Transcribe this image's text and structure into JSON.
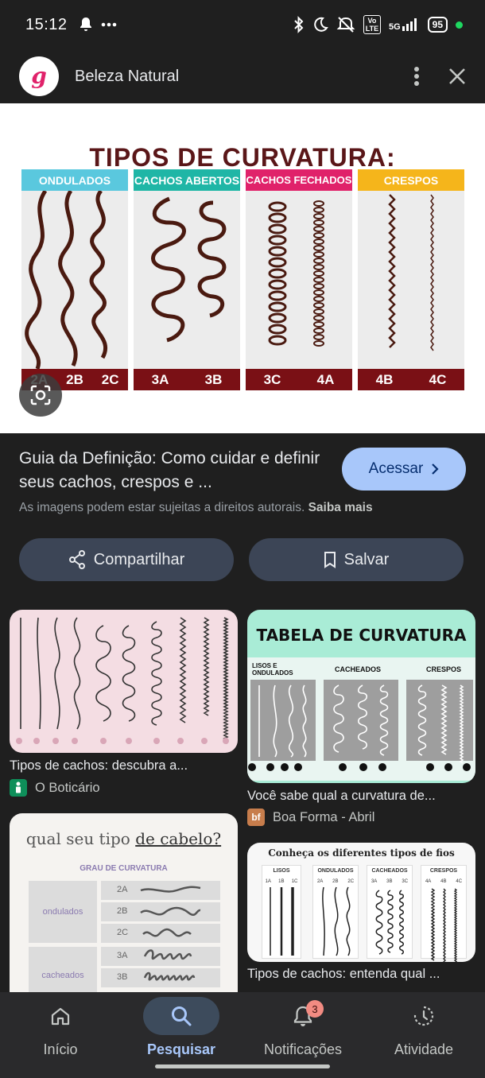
{
  "status_bar": {
    "time": "15:12",
    "lte_label": "Vo LTE",
    "network": "5G",
    "battery": "95",
    "icons": [
      "notification-bell-icon",
      "more-dots-icon",
      "bluetooth-icon",
      "moon-icon",
      "mute-icon",
      "signal-icon",
      "battery-icon"
    ]
  },
  "header": {
    "site_name": "Beleza Natural",
    "logo_letter": "g",
    "icons": [
      "more-vert-icon",
      "close-icon"
    ]
  },
  "hero": {
    "title": "TIPOS DE CURVATURA:",
    "panels": [
      {
        "label": "ONDULADOS",
        "color": "#5ac8de",
        "types": [
          "2A",
          "2B",
          "2C"
        ]
      },
      {
        "label": "CACHOS ABERTOS",
        "color": "#1fb6a6",
        "types": [
          "3A",
          "3B"
        ]
      },
      {
        "label": "CACHOS FECHADOS",
        "color": "#e0226a",
        "types": [
          "3C",
          "4A"
        ]
      },
      {
        "label": "CRESPOS",
        "color": "#f5b51b",
        "types": [
          "4B",
          "4C"
        ]
      }
    ]
  },
  "result": {
    "title": "Guia da Definição: Como cuidar e definir seus cachos, crespos e ...",
    "visit_label": "Acessar",
    "copyright_text": "As imagens podem estar sujeitas a direitos autorais.",
    "learn_more": "Saiba mais",
    "share_label": "Compartilhar",
    "save_label": "Salvar"
  },
  "related": [
    {
      "caption": "Tipos de cachos: descubra a...",
      "source": "O Boticário",
      "favicon": "",
      "favicon_color": "#0e8f5a"
    },
    {
      "caption": "Você sabe qual a curvatura de...",
      "source": "Boa Forma - Abril",
      "favicon": "bf",
      "favicon_color": "#c77d4c",
      "image_title": "TABELA DE CURVATURA",
      "columns": [
        "LISOS E ONDULADOS",
        "CACHEADOS",
        "CRESPOS"
      ]
    },
    {
      "image_title": "qual seu tipo",
      "image_title_em": "de cabelo?",
      "subtitle": "GRAU DE CURVATURA",
      "groups": [
        {
          "name": "ondulados",
          "rows": [
            "2A",
            "2B",
            "2C"
          ]
        },
        {
          "name": "cacheados",
          "rows": [
            "3A",
            "3B"
          ]
        }
      ]
    },
    {
      "caption": "Tipos de cachos: entenda qual ...",
      "image_title": "Conheça os diferentes tipos de fios",
      "columns": [
        {
          "name": "LISOS",
          "types": [
            "1A",
            "1B",
            "1C"
          ]
        },
        {
          "name": "ONDULADOS",
          "types": [
            "2A",
            "2B",
            "2C"
          ]
        },
        {
          "name": "CACHEADOS",
          "types": [
            "3A",
            "3B",
            "3C"
          ]
        },
        {
          "name": "CRESPOS",
          "types": [
            "4A",
            "4B",
            "4C"
          ]
        }
      ]
    }
  ],
  "nav": [
    {
      "label": "Início",
      "icon": "home-icon"
    },
    {
      "label": "Pesquisar",
      "icon": "search-icon",
      "active": true
    },
    {
      "label": "Notificações",
      "icon": "bell-icon",
      "badge": "3"
    },
    {
      "label": "Atividade",
      "icon": "history-icon"
    }
  ]
}
